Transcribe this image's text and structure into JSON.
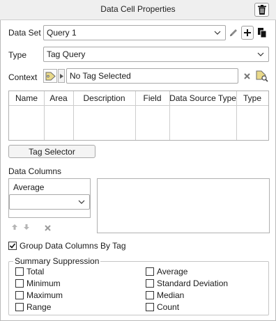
{
  "panel": {
    "title": "Data Cell Properties"
  },
  "dataset": {
    "label": "Data Set",
    "value": "Query 1"
  },
  "type": {
    "label": "Type",
    "value": "Tag Query"
  },
  "context": {
    "label": "Context",
    "value": "No Tag Selected"
  },
  "table": {
    "columns": [
      "Name",
      "Area",
      "Description",
      "Field",
      "Data Source Type",
      "Type"
    ]
  },
  "tag_selector": {
    "label": "Tag Selector"
  },
  "data_columns": {
    "label": "Data Columns",
    "selected": "Average",
    "dropdown_value": ""
  },
  "group_by": {
    "label": "Group Data Columns By Tag",
    "checked": true
  },
  "summary": {
    "legend": "Summary Suppression",
    "left": [
      "Total",
      "Minimum",
      "Maximum",
      "Range"
    ],
    "right": [
      "Average",
      "Standard Deviation",
      "Median",
      "Count"
    ]
  },
  "icons": {
    "trash": "trash-icon",
    "edit": "pencil-icon",
    "add": "plus-icon",
    "copy": "copy-icon",
    "tag": "tag-icon",
    "arrow": "play-arrow-icon",
    "clear": "x-icon",
    "tag_search": "tag-search-icon",
    "up": "arrow-up-icon",
    "down": "arrow-down-icon",
    "remove": "x-icon"
  }
}
